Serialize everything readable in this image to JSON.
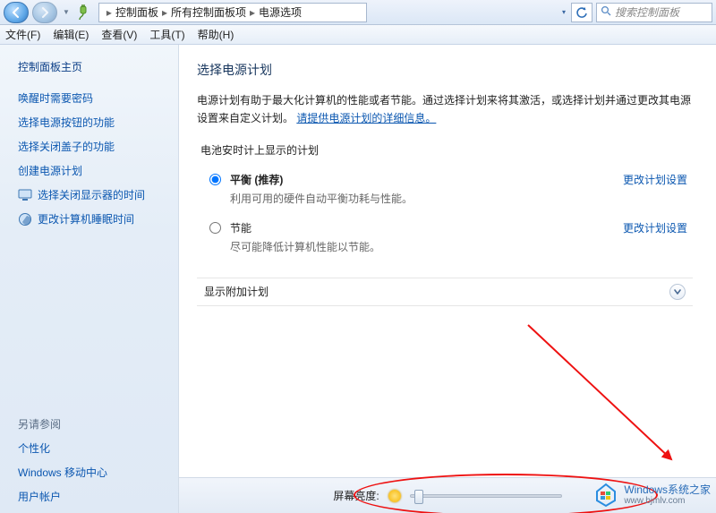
{
  "titlebar": {
    "breadcrumb": {
      "root": "控制面板",
      "mid": "所有控制面板项",
      "leaf": "电源选项"
    },
    "search_placeholder": "搜索控制面板"
  },
  "menubar": {
    "file": "文件(F)",
    "edit": "编辑(E)",
    "view": "查看(V)",
    "tools": "工具(T)",
    "help": "帮助(H)"
  },
  "sidebar": {
    "home": "控制面板主页",
    "links": {
      "wake_password": "唤醒时需要密码",
      "power_button": "选择电源按钮的功能",
      "close_lid": "选择关闭盖子的功能",
      "create_plan": "创建电源计划",
      "display_off": "选择关闭显示器的时间",
      "sleep_time": "更改计算机睡眠时间"
    },
    "see_also": "另请参阅",
    "bottom": {
      "personalize": "个性化",
      "mobility": "Windows 移动中心",
      "users": "用户帐户"
    }
  },
  "main": {
    "heading": "选择电源计划",
    "desc_pre": "电源计划有助于最大化计算机的性能或者节能。通过选择计划来将其激活，或选择计划并通过更改其电源设置来自定义计划。",
    "desc_link": "请提供电源计划的详细信息。",
    "section_title": "电池安时计上显示的计划",
    "plans": {
      "balanced": {
        "name": "平衡 (推荐)",
        "sub": "利用可用的硬件自动平衡功耗与性能。",
        "change": "更改计划设置"
      },
      "saver": {
        "name": "节能",
        "sub": "尽可能降低计算机性能以节能。",
        "change": "更改计划设置"
      }
    },
    "expand_label": "显示附加计划",
    "brightness_label": "屏幕亮度:",
    "brightness_pct": 3
  },
  "watermark": {
    "title": "Windows系统之家",
    "url": "www.bjmlv.com"
  }
}
